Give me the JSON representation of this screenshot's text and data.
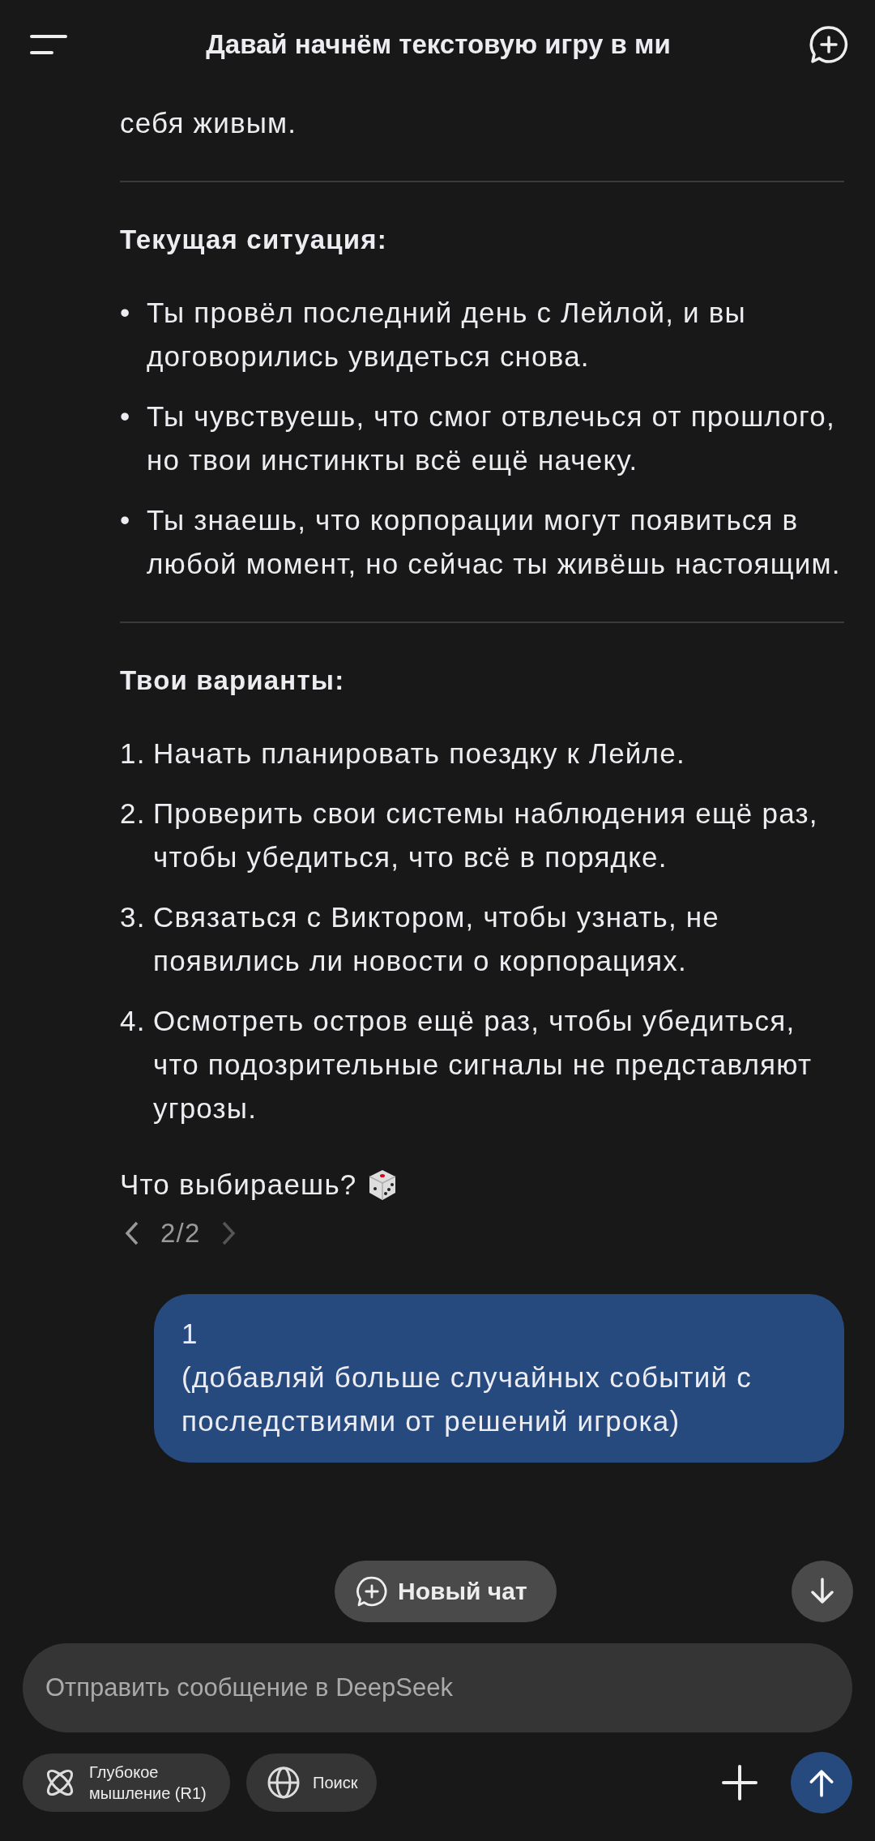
{
  "header": {
    "title": "Давай начнём текстовую игру в ми"
  },
  "message": {
    "intro": "себя живым.",
    "sections": [
      {
        "heading": "Текущая ситуация:",
        "kind": "bullet",
        "items": [
          {
            "marker": "•",
            "text": "Ты провёл последний день с Лейлой, и вы договорились увидеться снова."
          },
          {
            "marker": "•",
            "text": "Ты чувствуешь, что смог отвлечься от прошлого, но твои инстинкты всё ещё начеку."
          },
          {
            "marker": "•",
            "text": "Ты знаешь, что корпорации могут появиться в любой момент, но сейчас ты живёшь настоящим."
          }
        ]
      },
      {
        "heading": "Твои варианты:",
        "kind": "numbered",
        "items": [
          {
            "marker": "1.",
            "text": "Начать планировать поездку к Лейле."
          },
          {
            "marker": "2.",
            "text": "Проверить свои системы наблюдения ещё раз, чтобы убедиться, что всё в порядке."
          },
          {
            "marker": "3.",
            "text": "Связаться с Виктором, чтобы узнать, не появились ли новости о корпорациях."
          },
          {
            "marker": "4.",
            "text": "Осмотреть остров ещё раз, чтобы убедиться, что подозрительные сигналы не представляют угрозы."
          }
        ]
      }
    ],
    "closing": "Что выбираешь?",
    "pager": {
      "label": "2/2",
      "prev_disabled": false,
      "next_disabled": true
    }
  },
  "user_message": {
    "lines": [
      "1",
      "(добавляй больше случайных событий с последствиями от решений игрока)"
    ]
  },
  "new_chat_button": {
    "label": "Новый чат"
  },
  "composer": {
    "placeholder": "Отправить сообщение в DeepSeek",
    "toggles": [
      {
        "kind": "deepthink",
        "label": "Глубокое мышление (R1)",
        "selected": false
      },
      {
        "kind": "search",
        "label": "Поиск",
        "selected": false
      }
    ]
  }
}
